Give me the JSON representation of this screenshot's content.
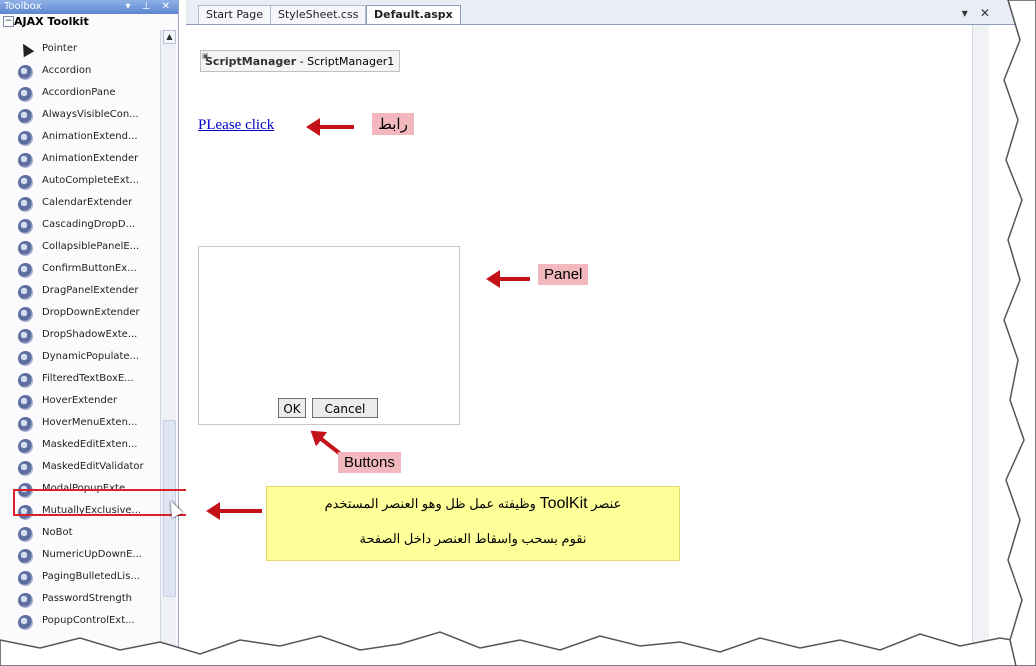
{
  "toolbox": {
    "title": "Toolbox",
    "window_controls": "▾ ⊥ ✕",
    "group": "AJAX Toolkit",
    "items": [
      {
        "label": "Pointer"
      },
      {
        "label": "Accordion"
      },
      {
        "label": "AccordionPane"
      },
      {
        "label": "AlwaysVisibleCon..."
      },
      {
        "label": "AnimationExtend..."
      },
      {
        "label": "AnimationExtender"
      },
      {
        "label": "AutoCompleteExt..."
      },
      {
        "label": "CalendarExtender"
      },
      {
        "label": "CascadingDropD..."
      },
      {
        "label": "CollapsiblePanelE..."
      },
      {
        "label": "ConfirmButtonEx..."
      },
      {
        "label": "DragPanelExtender"
      },
      {
        "label": "DropDownExtender"
      },
      {
        "label": "DropShadowExte..."
      },
      {
        "label": "DynamicPopulate..."
      },
      {
        "label": "FilteredTextBoxE..."
      },
      {
        "label": "HoverExtender"
      },
      {
        "label": "HoverMenuExten..."
      },
      {
        "label": "MaskedEditExten..."
      },
      {
        "label": "MaskedEditValidator"
      },
      {
        "label": "ModalPopupExte..."
      },
      {
        "label": "MutuallyExclusive..."
      },
      {
        "label": "NoBot"
      },
      {
        "label": "NumericUpDownE..."
      },
      {
        "label": "PagingBulletedLis..."
      },
      {
        "label": "PasswordStrength"
      },
      {
        "label": "PopupControlExt..."
      }
    ]
  },
  "editor": {
    "tabs": [
      {
        "label": "Start Page"
      },
      {
        "label": "StyleSheet.css"
      },
      {
        "label": "Default.aspx",
        "active": true
      }
    ],
    "tab_controls": "▾ ✕",
    "script_manager": {
      "type": "ScriptManager",
      "id": "ScriptManager1"
    },
    "link_text": "PLease click",
    "ok_label": "OK",
    "cancel_label": "Cancel"
  },
  "annotations": {
    "link_callout": "رابط",
    "panel_callout": "Panel",
    "buttons_callout": "Buttons",
    "note_line1_a": "عنصر",
    "note_line1_toolkit": "ToolKit",
    "note_line1_b": "وظيفته عمل ظل وهو العنصر المستخدم",
    "note_line2": "نقوم بسحب واسقاط العنصر داخل الصفحة",
    "arrow_color": "#c4121a",
    "callout_color": "#f3b8bd",
    "note_color": "#ffff99"
  }
}
